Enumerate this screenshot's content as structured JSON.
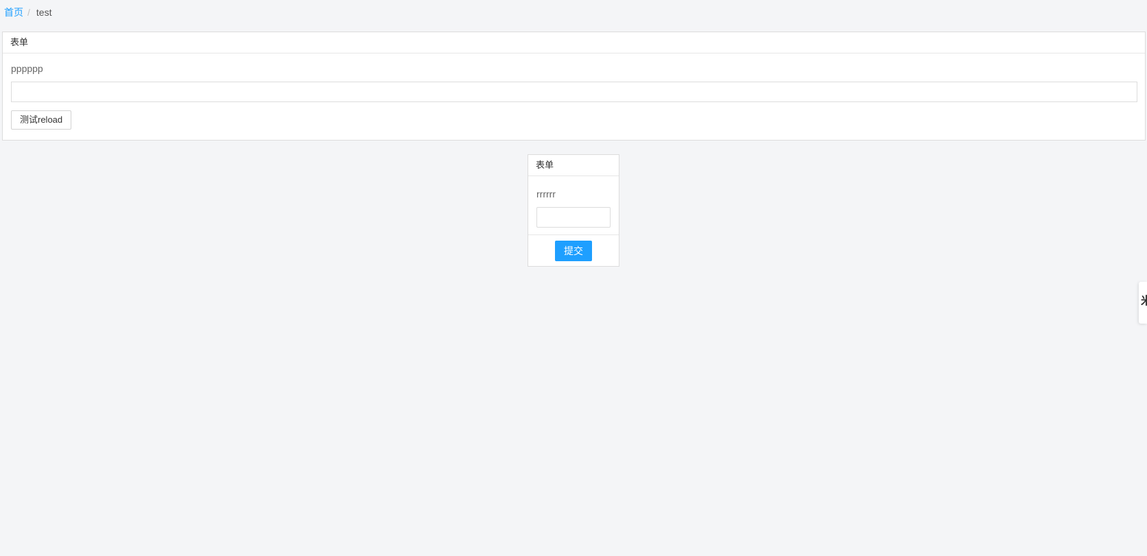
{
  "breadcrumb": {
    "home": "首页",
    "separator": "/",
    "current": "test"
  },
  "top_form": {
    "title": "表单",
    "field_label": "pppppp",
    "input_value": "",
    "button_label": "测试reload"
  },
  "mid_form": {
    "title": "表单",
    "field_label": "rrrrrr",
    "input_value": "",
    "submit_label": "提交"
  },
  "side_tab": {
    "glyph": "米"
  },
  "colors": {
    "accent": "#1e9fff",
    "background": "#f4f5f7"
  }
}
